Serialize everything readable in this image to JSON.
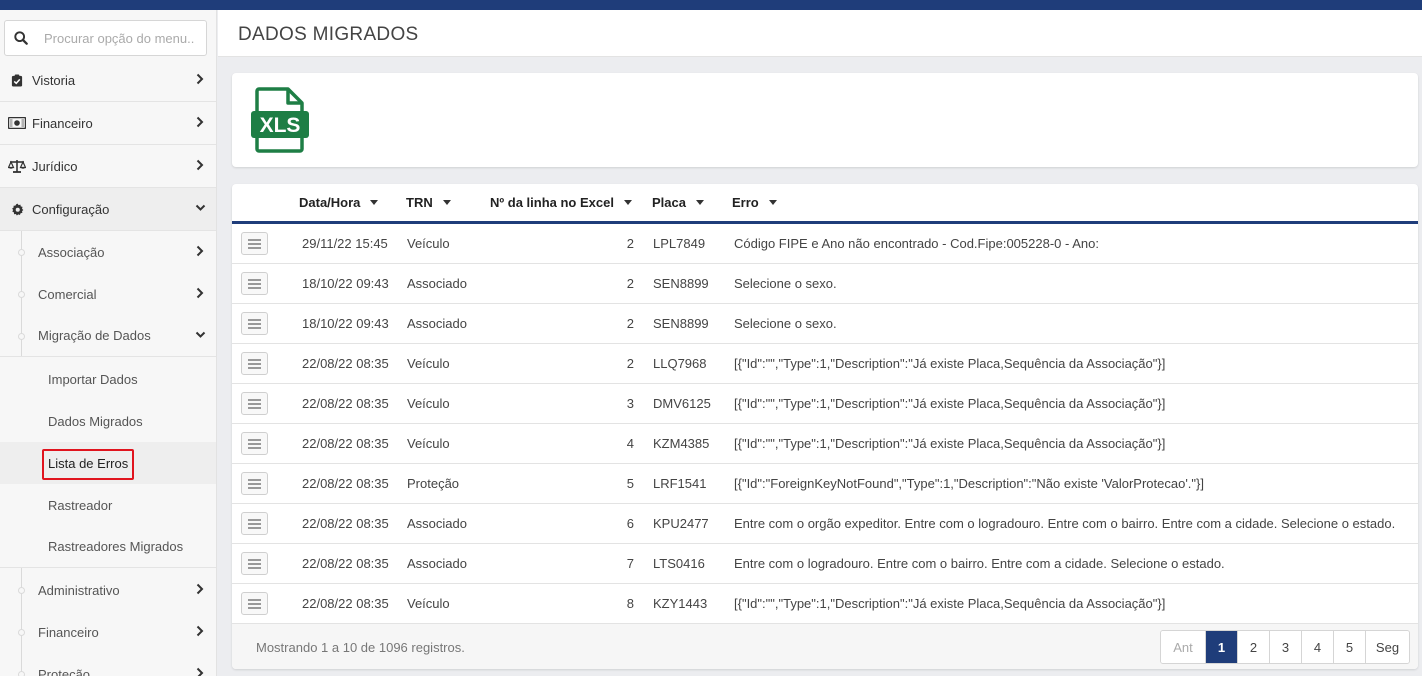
{
  "colors": {
    "brand": "#1f3d7a",
    "xls_green": "#1e7e45",
    "highlight": "#e0141e"
  },
  "search": {
    "placeholder": "Procurar opção do menu..."
  },
  "sidebar": {
    "top_items": [
      {
        "label": "Vistoria",
        "icon": "clipboard-check-icon"
      },
      {
        "label": "Financeiro",
        "icon": "money-bill-icon"
      },
      {
        "label": "Jurídico",
        "icon": "balance-scale-icon"
      },
      {
        "label": "Configuração",
        "icon": "gear-icon"
      }
    ],
    "sub_items": [
      {
        "label": "Associação"
      },
      {
        "label": "Comercial"
      },
      {
        "label": "Migração de Dados"
      }
    ],
    "leaf_items": [
      {
        "label": "Importar Dados"
      },
      {
        "label": "Dados Migrados"
      },
      {
        "label": "Lista de Erros"
      },
      {
        "label": "Rastreador"
      },
      {
        "label": "Rastreadores Migrados"
      }
    ],
    "more_sub_items": [
      {
        "label": "Administrativo"
      },
      {
        "label": "Financeiro"
      },
      {
        "label": "Proteção"
      }
    ]
  },
  "header": {
    "title": "DADOS MIGRADOS"
  },
  "export": {
    "label": "XLS",
    "icon": "xls-file-icon"
  },
  "table": {
    "columns": [
      "Data/Hora",
      "TRN",
      "Nº da linha no Excel",
      "Placa",
      "Erro"
    ],
    "rows": [
      {
        "datetime": "29/11/22 15:45",
        "trn": "Veículo",
        "line": "2",
        "plate": "LPL7849",
        "error": "Código FIPE e Ano não encontrado - Cod.Fipe:005228-0 - Ano:"
      },
      {
        "datetime": "18/10/22 09:43",
        "trn": "Associado",
        "line": "2",
        "plate": "SEN8899",
        "error": "Selecione o sexo."
      },
      {
        "datetime": "18/10/22 09:43",
        "trn": "Associado",
        "line": "2",
        "plate": "SEN8899",
        "error": "Selecione o sexo."
      },
      {
        "datetime": "22/08/22 08:35",
        "trn": "Veículo",
        "line": "2",
        "plate": "LLQ7968",
        "error": "[{\"Id\":\"\",\"Type\":1,\"Description\":\"Já existe Placa,Sequência da Associação\"}]"
      },
      {
        "datetime": "22/08/22 08:35",
        "trn": "Veículo",
        "line": "3",
        "plate": "DMV6125",
        "error": "[{\"Id\":\"\",\"Type\":1,\"Description\":\"Já existe Placa,Sequência da Associação\"}]"
      },
      {
        "datetime": "22/08/22 08:35",
        "trn": "Veículo",
        "line": "4",
        "plate": "KZM4385",
        "error": "[{\"Id\":\"\",\"Type\":1,\"Description\":\"Já existe Placa,Sequência da Associação\"}]"
      },
      {
        "datetime": "22/08/22 08:35",
        "trn": "Proteção",
        "line": "5",
        "plate": "LRF1541",
        "error": "[{\"Id\":\"ForeignKeyNotFound\",\"Type\":1,\"Description\":\"Não existe 'ValorProtecao'.\"}]"
      },
      {
        "datetime": "22/08/22 08:35",
        "trn": "Associado",
        "line": "6",
        "plate": "KPU2477",
        "error": "Entre com o orgão expeditor. Entre com o logradouro. Entre com o bairro. Entre com a cidade. Selecione o estado."
      },
      {
        "datetime": "22/08/22 08:35",
        "trn": "Associado",
        "line": "7",
        "plate": "LTS0416",
        "error": "Entre com o logradouro. Entre com o bairro. Entre com a cidade. Selecione o estado."
      },
      {
        "datetime": "22/08/22 08:35",
        "trn": "Veículo",
        "line": "8",
        "plate": "KZY1443",
        "error": "[{\"Id\":\"\",\"Type\":1,\"Description\":\"Já existe Placa,Sequência da Associação\"}]"
      }
    ]
  },
  "footer": {
    "summary": "Mostrando 1 a 10 de 1096 registros."
  },
  "pagination": {
    "prev": "Ant",
    "pages": [
      "1",
      "2",
      "3",
      "4",
      "5"
    ],
    "current": "1",
    "next": "Seg"
  }
}
